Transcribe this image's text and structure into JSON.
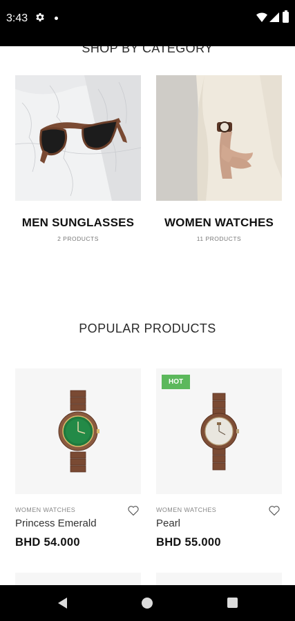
{
  "status_bar": {
    "time": "3:43"
  },
  "sections": {
    "categories_heading": "SHOP BY CATEGORY",
    "popular_heading": "POPULAR PRODUCTS"
  },
  "categories": [
    {
      "title": "MEN SUNGLASSES",
      "count": "2 PRODUCTS"
    },
    {
      "title": "WOMEN WATCHES",
      "count": "11 PRODUCTS"
    }
  ],
  "products": [
    {
      "category": "WOMEN WATCHES",
      "name": "Princess Emerald",
      "price": "BHD 54.000",
      "badge": ""
    },
    {
      "category": "WOMEN WATCHES",
      "name": "Pearl",
      "price": "BHD 55.000",
      "badge": "HOT"
    }
  ],
  "colors": {
    "hot_badge": "#5cb85c",
    "wood": "#7a4a33",
    "emerald_dial": "#1f7a3e",
    "pearl_dial": "#e9e6df"
  },
  "icons": [
    "gear-icon",
    "wifi-icon",
    "signal-icon",
    "battery-icon",
    "heart-icon",
    "back-icon",
    "home-icon",
    "recents-icon"
  ]
}
